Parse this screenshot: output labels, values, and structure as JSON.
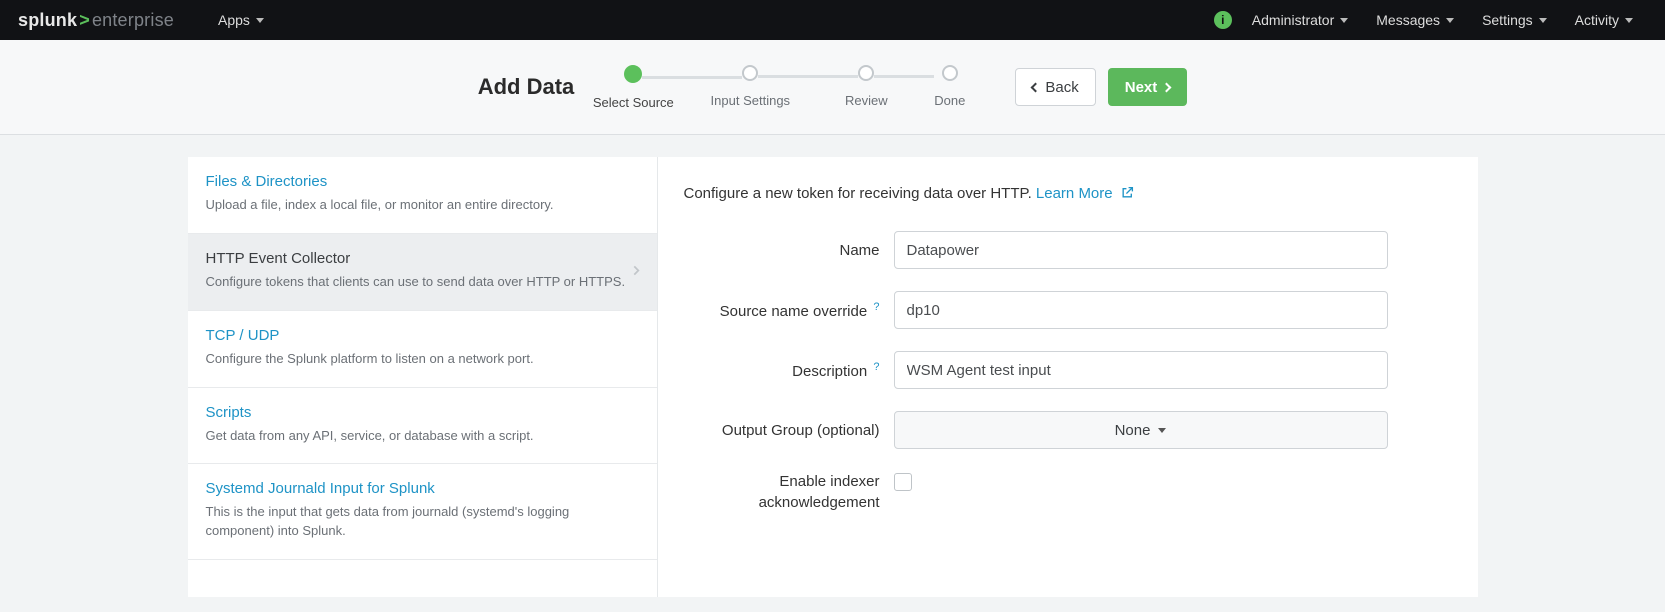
{
  "brand": {
    "part1": "splunk",
    "gt": ">",
    "part2": "enterprise"
  },
  "nav": {
    "apps": "Apps",
    "admin": "Administrator",
    "messages": "Messages",
    "settings": "Settings",
    "activity": "Activity"
  },
  "header": {
    "title": "Add Data",
    "steps": {
      "select_source": "Select Source",
      "input_settings": "Input Settings",
      "review": "Review",
      "done": "Done"
    },
    "back": "Back",
    "next": "Next"
  },
  "sources": [
    {
      "title": "Files & Directories",
      "desc": "Upload a file, index a local file, or monitor an entire directory."
    },
    {
      "title": "HTTP Event Collector",
      "desc": "Configure tokens that clients can use to send data over HTTP or HTTPS."
    },
    {
      "title": "TCP / UDP",
      "desc": "Configure the Splunk platform to listen on a network port."
    },
    {
      "title": "Scripts",
      "desc": "Get data from any API, service, or database with a script."
    },
    {
      "title": "Systemd Journald Input for Splunk",
      "desc": "This is the input that gets data from journald (systemd's logging component) into Splunk."
    }
  ],
  "form": {
    "intro_text": "Configure a new token for receiving data over HTTP. ",
    "learn_more": "Learn More",
    "labels": {
      "name": "Name",
      "source_override": "Source name override",
      "description": "Description",
      "output_group": "Output Group (optional)",
      "enable_indexer_ack_l1": "Enable indexer",
      "enable_indexer_ack_l2": "acknowledgement"
    },
    "values": {
      "name": "Datapower",
      "source_override": "dp10",
      "description": "WSM Agent test input",
      "output_group": "None"
    },
    "help_q": "?"
  },
  "info_glyph": "i"
}
